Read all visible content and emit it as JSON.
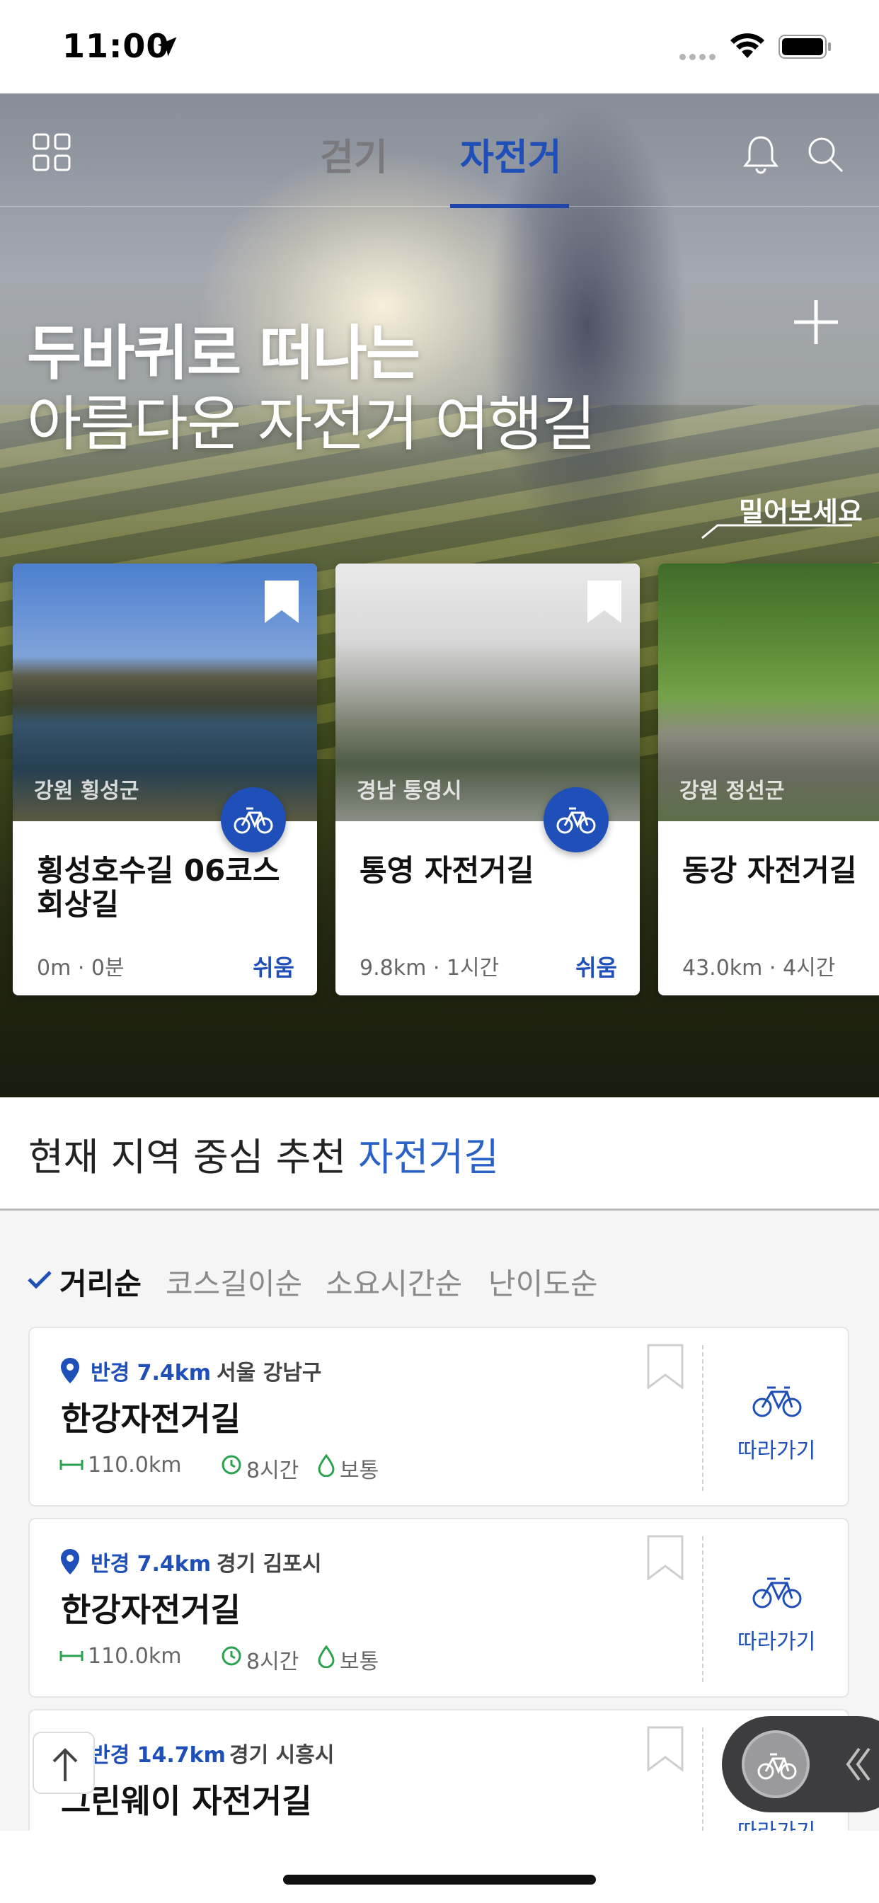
{
  "status_bar": {
    "time": "11:00"
  },
  "top_nav": {
    "tabs": [
      {
        "label": "걷기",
        "active": false
      },
      {
        "label": "자전거",
        "active": true
      }
    ],
    "accent_color": "#1f4fb8"
  },
  "hero": {
    "title_line1": "두바퀴로 떠나는",
    "title_line2": "아름다운 자전거 여행길",
    "swipe_hint": "밀어보세요"
  },
  "cards": [
    {
      "region": "강원 횡성군",
      "title": "횡성호수길 06코스 회상길",
      "meta": "0m · 0분",
      "level": "쉬움"
    },
    {
      "region": "경남 통영시",
      "title": "통영 자전거길",
      "meta": "9.8km · 1시간",
      "level": "쉬움"
    },
    {
      "region": "강원 정선군",
      "title": "동강 자전거길",
      "meta": "43.0km · 4시간",
      "level": ""
    }
  ],
  "section": {
    "title_prefix": "현재 지역 중심 추천 ",
    "title_accent": "자전거길"
  },
  "sort_options": [
    {
      "label": "거리순",
      "selected": true
    },
    {
      "label": "코스길이순",
      "selected": false
    },
    {
      "label": "소요시간순",
      "selected": false
    },
    {
      "label": "난이도순",
      "selected": false
    }
  ],
  "list_items": [
    {
      "radius": "반경 7.4km",
      "region": "서울 강남구",
      "title": "한강자전거길",
      "length": "110.0km",
      "time": "8시간",
      "level": "보통",
      "follow": "따라가기"
    },
    {
      "radius": "반경 7.4km",
      "region": "경기 김포시",
      "title": "한강자전거길",
      "length": "110.0km",
      "time": "8시간",
      "level": "보통",
      "follow": "따라가기"
    },
    {
      "radius": "반경 14.7km",
      "region": "경기 시흥시",
      "title": "그린웨이 자전거길",
      "length": "",
      "time": "",
      "level": "",
      "follow": "따라가기"
    }
  ],
  "icons": [
    "grid-icon",
    "bell-icon",
    "search-icon",
    "plus-icon",
    "bookmark-icon",
    "bicycle-icon",
    "pin-icon",
    "ruler-icon",
    "clock-icon",
    "drop-icon",
    "check-icon",
    "arrow-up-icon",
    "chevron-left-icon"
  ]
}
